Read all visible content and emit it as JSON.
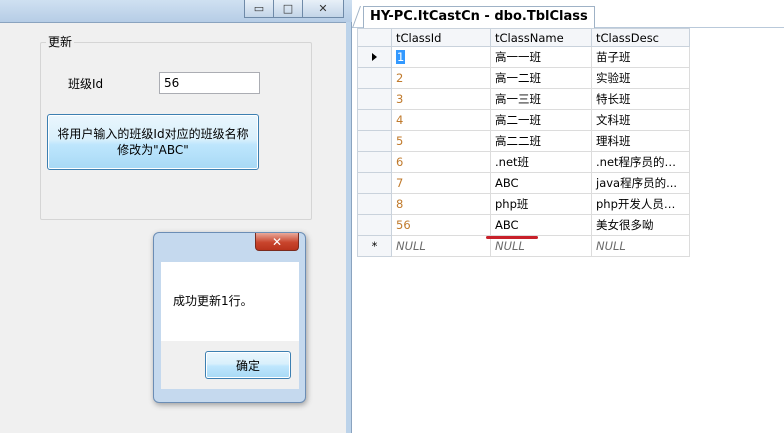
{
  "left_window": {
    "caption_buttons": {
      "minimize": "▭",
      "maximize": "□",
      "close": "✕"
    },
    "group_title": "更新",
    "class_id_label": "班级Id",
    "class_id_value": "56",
    "update_button": "将用户输入的班级Id对应的班级名称\n修改为\"ABC\""
  },
  "message_box": {
    "close": "✕",
    "text": "成功更新1行。",
    "ok": "确定"
  },
  "results": {
    "tab_title": "HY-PC.ItCastCn - dbo.TblClass",
    "columns": [
      "tClassId",
      "tClassName",
      "tClassDesc"
    ],
    "rows": [
      {
        "id": "1",
        "name": "高一一班",
        "desc": "苗子班"
      },
      {
        "id": "2",
        "name": "高一二班",
        "desc": "实验班"
      },
      {
        "id": "3",
        "name": "高一三班",
        "desc": "特长班"
      },
      {
        "id": "4",
        "name": "高二一班",
        "desc": "文科班"
      },
      {
        "id": "5",
        "name": "高二二班",
        "desc": "理科班"
      },
      {
        "id": "6",
        "name": ".net班",
        "desc": ".net程序员的摇篮"
      },
      {
        "id": "7",
        "name": "ABC",
        "desc": "java程序员的..."
      },
      {
        "id": "8",
        "name": "php班",
        "desc": "php开发人员的..."
      },
      {
        "id": "56",
        "name": "ABC",
        "desc": "美女很多呦"
      }
    ],
    "new_row": {
      "marker": "*",
      "id": "NULL",
      "name": "NULL",
      "desc": "NULL"
    }
  },
  "colors": {
    "highlight": "#3399ff",
    "id_text": "#c07a2c",
    "annotation": "#c8202a"
  }
}
